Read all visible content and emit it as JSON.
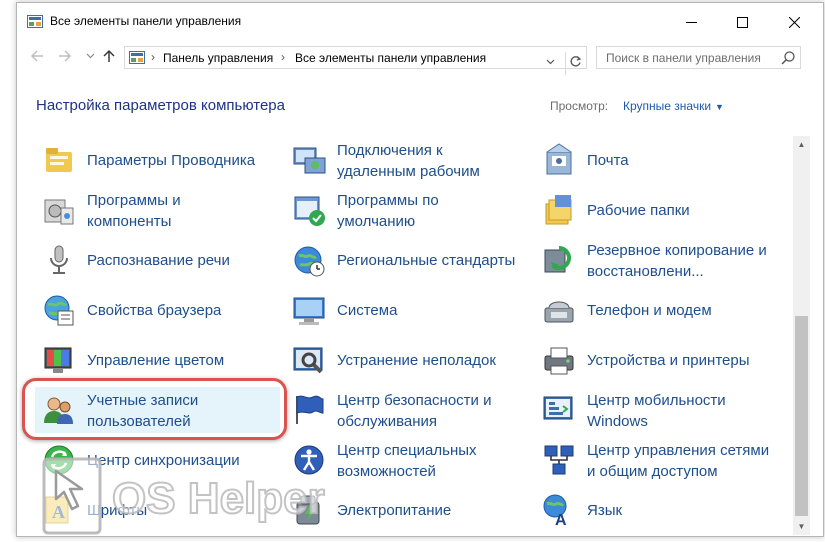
{
  "window": {
    "title": "Все элементы панели управления",
    "controls": {
      "minimize": "—",
      "maximize": "☐",
      "close": "✕"
    }
  },
  "navbar": {
    "back_icon": "arrow-left-icon",
    "forward_icon": "arrow-right-icon",
    "recent_icon": "chevron-down-icon",
    "up_icon": "arrow-up-icon",
    "breadcrumbs": [
      "Панель управления",
      "Все элементы панели управления"
    ],
    "separator": "›",
    "search_placeholder": "Поиск в панели управления"
  },
  "header": {
    "title": "Настройка параметров компьютера",
    "view_label": "Просмотр:",
    "view_value": "Крупные значки"
  },
  "items": [
    {
      "icon": "folder-options-icon",
      "lines": [
        "Параметры Проводника"
      ]
    },
    {
      "icon": "remote-desktop-icon",
      "lines": [
        "Подключения к",
        "удаленным рабочим"
      ]
    },
    {
      "icon": "mail-icon",
      "lines": [
        "Почта"
      ]
    },
    {
      "icon": "programs-features-icon",
      "lines": [
        "Программы и",
        "компоненты"
      ]
    },
    {
      "icon": "default-programs-icon",
      "lines": [
        "Программы по",
        "умолчанию"
      ]
    },
    {
      "icon": "work-folders-icon",
      "lines": [
        "Рабочие папки"
      ]
    },
    {
      "icon": "speech-recognition-icon",
      "lines": [
        "Распознавание речи"
      ]
    },
    {
      "icon": "region-icon",
      "lines": [
        "Региональные стандарты"
      ]
    },
    {
      "icon": "backup-restore-icon",
      "lines": [
        "Резервное копирование и",
        "восстановлени..."
      ]
    },
    {
      "icon": "internet-options-icon",
      "lines": [
        "Свойства браузера"
      ]
    },
    {
      "icon": "system-icon",
      "lines": [
        "Система"
      ]
    },
    {
      "icon": "phone-modem-icon",
      "lines": [
        "Телефон и модем"
      ]
    },
    {
      "icon": "color-management-icon",
      "lines": [
        "Управление цветом"
      ]
    },
    {
      "icon": "troubleshooting-icon",
      "lines": [
        "Устранение неполадок"
      ]
    },
    {
      "icon": "devices-printers-icon",
      "lines": [
        "Устройства и принтеры"
      ]
    },
    {
      "icon": "user-accounts-icon",
      "lines": [
        "Учетные записи",
        "пользователей"
      ]
    },
    {
      "icon": "security-maintenance-icon",
      "lines": [
        "Центр безопасности и",
        "обслуживания"
      ]
    },
    {
      "icon": "mobility-center-icon",
      "lines": [
        "Центр мобильности",
        "Windows"
      ]
    },
    {
      "icon": "sync-center-icon",
      "lines": [
        "Центр синхронизации"
      ]
    },
    {
      "icon": "ease-of-access-icon",
      "lines": [
        "Центр специальных",
        "возможностей"
      ]
    },
    {
      "icon": "network-sharing-icon",
      "lines": [
        "Центр управления сетями",
        "и общим доступом"
      ]
    },
    {
      "icon": "fonts-icon",
      "lines": [
        "Шрифты"
      ]
    },
    {
      "icon": "power-options-icon",
      "lines": [
        "Электропитание"
      ]
    },
    {
      "icon": "language-icon",
      "lines": [
        "Язык"
      ]
    }
  ],
  "selected_item": "Учетные записи пользователей",
  "colors": {
    "link": "#1e4e8c",
    "heading": "#1e3287",
    "highlight_ring": "#d9534f",
    "selected_bg": "#e5f3fb"
  },
  "watermark": {
    "text": "OS Helper"
  }
}
